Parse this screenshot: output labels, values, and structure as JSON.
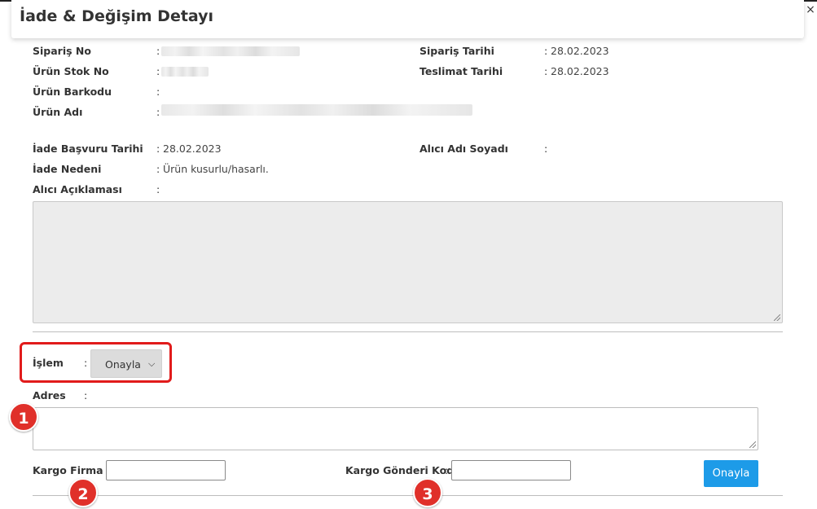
{
  "dialog": {
    "title": "İade & Değişim Detayı",
    "close_glyph": "×"
  },
  "order": {
    "siparis_no_label": "Sipariş No",
    "urun_stok_no_label": "Ürün Stok No",
    "urun_barkodu_label": "Ürün Barkodu",
    "urun_adi_label": "Ürün Adı",
    "siparis_tarihi_label": "Sipariş Tarihi",
    "siparis_tarihi_value": "28.02.2023",
    "teslimat_tarihi_label": "Teslimat Tarihi",
    "teslimat_tarihi_value": "28.02.2023"
  },
  "return": {
    "basvuru_tarihi_label": "İade Başvuru Tarihi",
    "basvuru_tarihi_value": "28.02.2023",
    "iade_nedeni_label": "İade Nedeni",
    "iade_nedeni_value": "Ürün kusurlu/hasarlı.",
    "alici_aciklamasi_label": "Alıcı Açıklaması",
    "alici_adi_soyadi_label": "Alıcı Adı Soyadı"
  },
  "separator": ":",
  "action": {
    "islem_label": "İşlem",
    "islem_selected": "Onayla",
    "adres_label": "Adres",
    "kargo_firma_label": "Kargo Firma",
    "kargo_gonderi_kodu_label": "Kargo Gönderi Kodu",
    "submit_label": "Onayla"
  },
  "annotations": {
    "badge_1": "1",
    "badge_2": "2",
    "badge_3": "3",
    "highlight_color": "#e11b1b",
    "badge_color": "#e0302a",
    "button_color": "#1d9be8"
  }
}
